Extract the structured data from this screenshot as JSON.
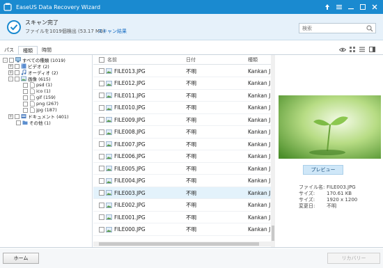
{
  "window": {
    "title": "EaseUS Data Recovery Wizard",
    "controls": [
      "upload-icon",
      "menu-icon",
      "minimize-icon",
      "maximize-icon",
      "close-icon"
    ]
  },
  "status": {
    "title": "スキャン完了",
    "subtitle": "ファイルを1019個検出 (53.17 MB)",
    "link": "スキャン結果"
  },
  "search": {
    "placeholder": "検索"
  },
  "tabs": [
    {
      "label": "パス",
      "active": false
    },
    {
      "label": "種類",
      "active": true
    },
    {
      "label": "時間",
      "active": false
    }
  ],
  "tree": [
    {
      "label": "すべての種類 (1019)",
      "expander": "-",
      "icon": "computer-icon"
    },
    {
      "label": "ビデオ (2)",
      "expander": "+",
      "icon": "video-icon"
    },
    {
      "label": "オーディオ (2)",
      "expander": "+",
      "icon": "music-icon"
    },
    {
      "label": "画像 (615)",
      "expander": "-",
      "icon": "image-icon"
    },
    {
      "label": "psd (1)",
      "expander": "",
      "icon": "file-icon"
    },
    {
      "label": "ico (1)",
      "expander": "",
      "icon": "file-icon"
    },
    {
      "label": "gif (159)",
      "expander": "",
      "icon": "file-icon"
    },
    {
      "label": "png (267)",
      "expander": "",
      "icon": "file-icon"
    },
    {
      "label": "jpg (187)",
      "expander": "",
      "icon": "file-icon"
    },
    {
      "label": "ドキュメント (401)",
      "expander": "+",
      "icon": "document-icon"
    },
    {
      "label": "その他 (1)",
      "expander": "",
      "icon": "folder-icon"
    }
  ],
  "list": {
    "columns": {
      "name": "名前",
      "date": "日付",
      "type": "種類"
    },
    "rows": [
      {
        "name": "FILE013.JPG",
        "date": "不明",
        "type": "Kankan J"
      },
      {
        "name": "FILE012.JPG",
        "date": "不明",
        "type": "Kankan J"
      },
      {
        "name": "FILE011.JPG",
        "date": "不明",
        "type": "Kankan J"
      },
      {
        "name": "FILE010.JPG",
        "date": "不明",
        "type": "Kankan J"
      },
      {
        "name": "FILE009.JPG",
        "date": "不明",
        "type": "Kankan J"
      },
      {
        "name": "FILE008.JPG",
        "date": "不明",
        "type": "Kankan J"
      },
      {
        "name": "FILE007.JPG",
        "date": "不明",
        "type": "Kankan J"
      },
      {
        "name": "FILE006.JPG",
        "date": "不明",
        "type": "Kankan J"
      },
      {
        "name": "FILE005.JPG",
        "date": "不明",
        "type": "Kankan J"
      },
      {
        "name": "FILE004.JPG",
        "date": "不明",
        "type": "Kankan J"
      },
      {
        "name": "FILE003.JPG",
        "date": "不明",
        "type": "Kankan J",
        "selected": true
      },
      {
        "name": "FILE002.JPG",
        "date": "不明",
        "type": "Kankan J"
      },
      {
        "name": "FILE001.JPG",
        "date": "不明",
        "type": "Kankan J"
      },
      {
        "name": "FILE000.JPG",
        "date": "不明",
        "type": "Kankan J"
      }
    ]
  },
  "preview": {
    "button": "プレビュー",
    "info": [
      {
        "key": "ファイル名:",
        "value": "FILE003.JPG"
      },
      {
        "key": "サイズ:",
        "value": "170.61 KB"
      },
      {
        "key": "サイズ:",
        "value": "1920 x 1200"
      },
      {
        "key": "変更日:",
        "value": "不明"
      }
    ]
  },
  "footer": {
    "home": "ホーム",
    "recover": "リカバリー"
  },
  "colors": {
    "accent": "#1a8ad0",
    "status_bg": "#e6f1fa",
    "selected_row": "#e3f2fb"
  }
}
